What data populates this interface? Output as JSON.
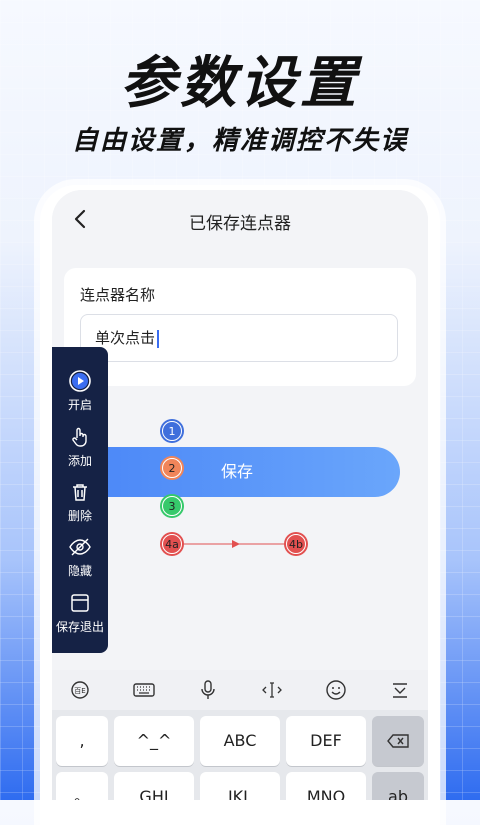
{
  "hero": {
    "title": "参数设置",
    "subtitle": "自由设置，精准调控不失误"
  },
  "app": {
    "title": "已保存连点器",
    "back_icon": "chevron-left-icon"
  },
  "form": {
    "name_label": "连点器名称",
    "name_value": "单次点击",
    "save_label": "保存"
  },
  "panel": {
    "items": [
      {
        "label": "开启",
        "icon": "play-icon"
      },
      {
        "label": "添加",
        "icon": "tap-hand-icon"
      },
      {
        "label": "删除",
        "icon": "trash-icon"
      },
      {
        "label": "隐藏",
        "icon": "eye-off-icon"
      },
      {
        "label": "保存退出",
        "icon": "save-exit-icon"
      }
    ]
  },
  "markers": [
    {
      "label": "1",
      "color": "#3f6fdc"
    },
    {
      "label": "2",
      "color": "#f0855a"
    },
    {
      "label": "3",
      "color": "#36c96b"
    },
    {
      "label": "4a",
      "color": "#e25050"
    },
    {
      "label": "4b",
      "color": "#e25050"
    }
  ],
  "keyboard": {
    "toolbar": [
      "emoji-logo-icon",
      "keyboard-icon",
      "mic-icon",
      "cursor-icon",
      "smiley-icon",
      "hide-keyboard-icon"
    ],
    "row1": [
      ",",
      "^_^",
      "ABC",
      "DEF"
    ],
    "row2": [
      "。",
      "GHI",
      "JKL",
      "MNO",
      "ab"
    ],
    "delete_icon": "backspace-icon"
  }
}
